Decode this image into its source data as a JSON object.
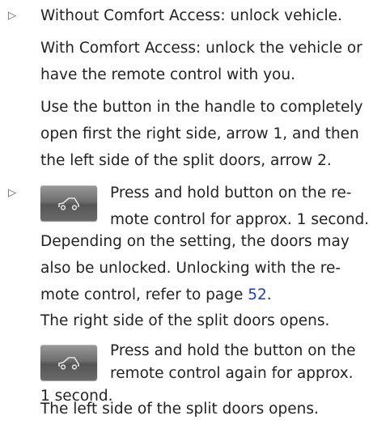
{
  "bullet_glyph": "▷",
  "item1": {
    "line1": "Without Comfort Access: unlock vehicle.",
    "para2": [
      "With Comfort Access: unlock the vehicle or",
      "have the remote control with you."
    ],
    "para3": [
      "Use the button in the handle to completely",
      "open first the right side, arrow 1, and then",
      "the left side of the split doors, arrow 2."
    ]
  },
  "item2": {
    "button_icon": "car-trunk-icon",
    "press1": [
      "Press and hold button on the re-",
      "mote control for approx. 1 second."
    ],
    "note": [
      "Depending on the setting, the doors may",
      "also be unlocked. Unlocking with the re-"
    ],
    "note_line3_prefix": "mote control, refer to page ",
    "page_link": "52",
    "note_line3_suffix": ".",
    "right_opens": "The right side of the split doors opens.",
    "press2": [
      "Press and hold the button on the",
      "remote control again for approx.",
      "1 second."
    ],
    "left_opens": "The left side of the split doors opens."
  }
}
